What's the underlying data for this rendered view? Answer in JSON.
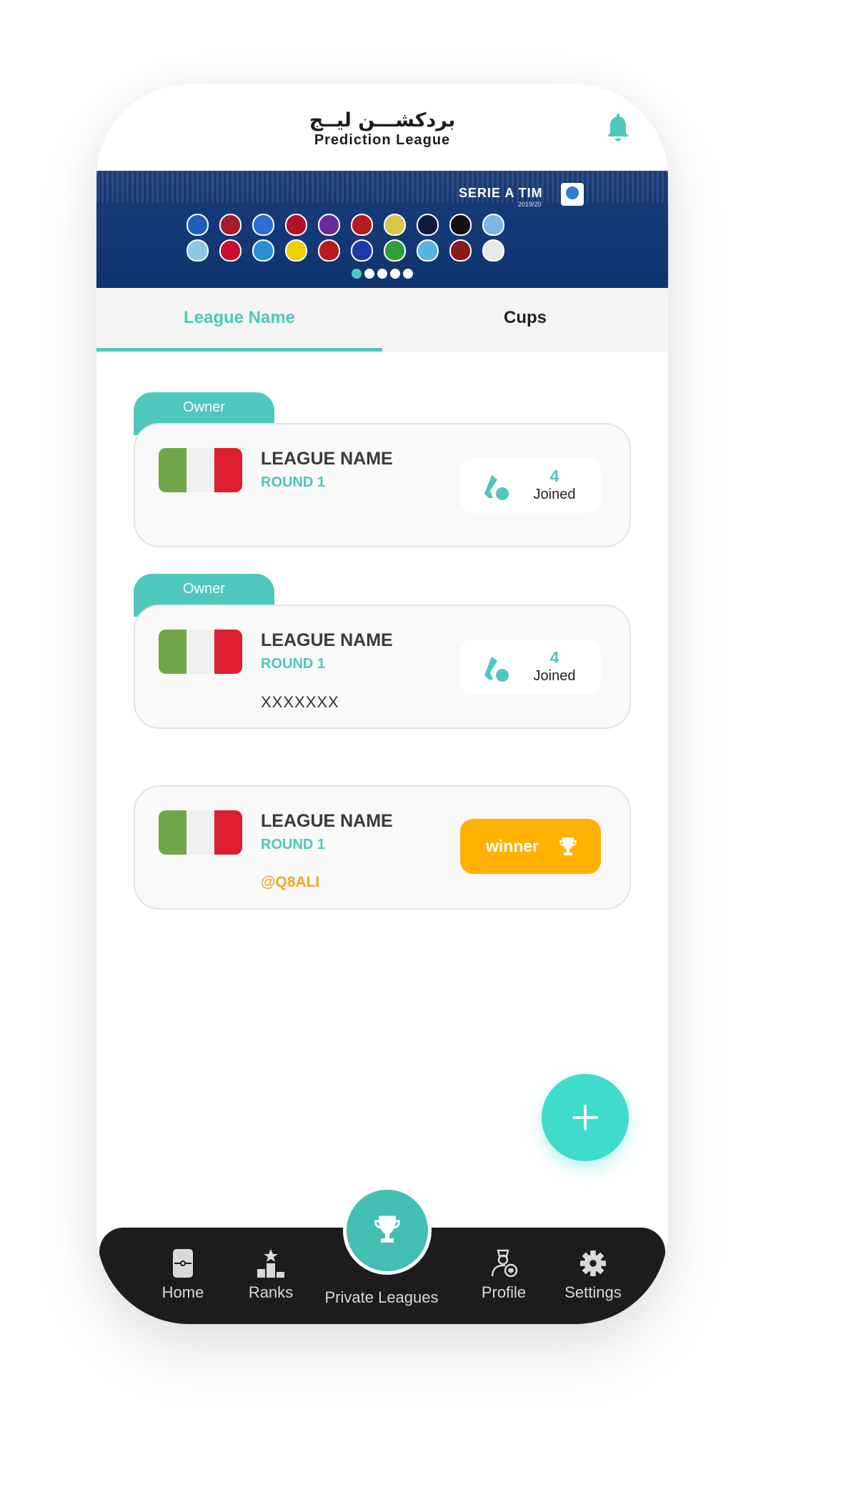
{
  "header": {
    "logo_arabic": "بردكشـــن ليــج",
    "logo_english": "Prediction League",
    "bell_icon": "bell-icon"
  },
  "banner": {
    "title": "SERIE A TIM",
    "season": "2019/20",
    "slides": 5,
    "active_slide": 0
  },
  "tabs": [
    {
      "label": "League Name",
      "active": true
    },
    {
      "label": "Cups",
      "active": false
    }
  ],
  "leagues": [
    {
      "tag": "Owner",
      "name": "LEAGUE NAME",
      "round": "ROUND 1",
      "extra": "",
      "joined_count": "4",
      "joined_label": "Joined"
    },
    {
      "tag": "Owner",
      "name": "LEAGUE NAME",
      "round": "ROUND 1",
      "extra": "XXXXXXX",
      "joined_count": "4",
      "joined_label": "Joined"
    },
    {
      "tag": "",
      "name": "LEAGUE NAME",
      "round": "ROUND 1",
      "extra": "@Q8ALI",
      "winner_label": "winner"
    }
  ],
  "nav": {
    "items": [
      {
        "label": "Home",
        "icon": "home-icon"
      },
      {
        "label": "Ranks",
        "icon": "ranks-icon"
      },
      {
        "label": "Private Leagues",
        "icon": "trophy-icon",
        "active": true
      },
      {
        "label": "Profile",
        "icon": "profile-icon"
      },
      {
        "label": "Settings",
        "icon": "gear-icon"
      }
    ]
  },
  "colors": {
    "accent": "#4ec7bd",
    "fab": "#3fdccb",
    "winner": "#ffb200",
    "nav_bg": "#1c1c1c",
    "banner_bg": "#163a78"
  }
}
